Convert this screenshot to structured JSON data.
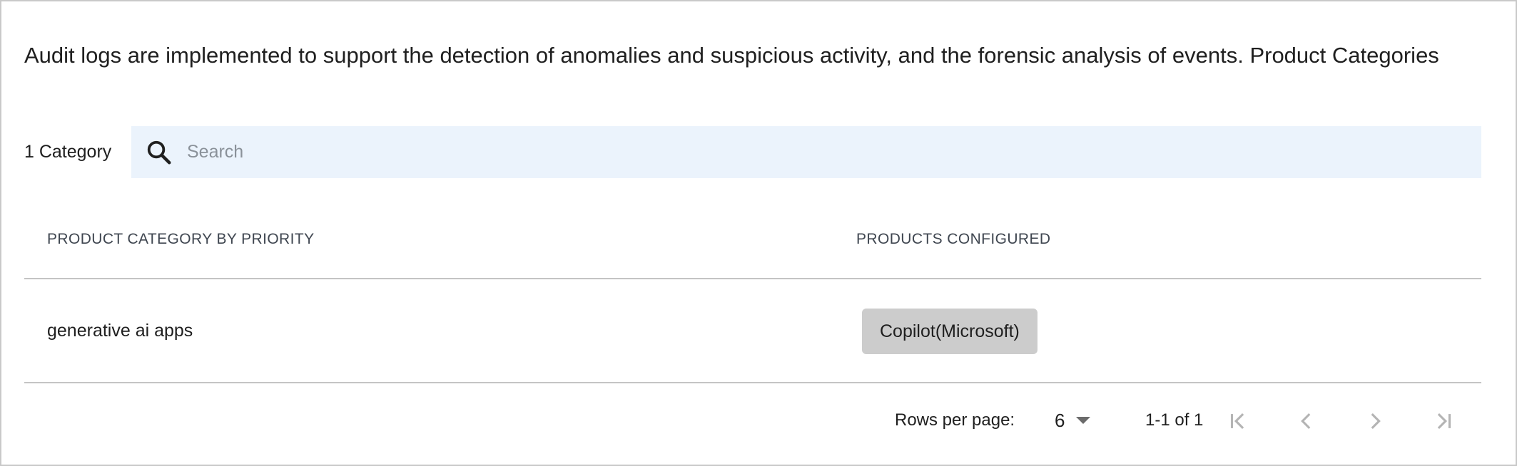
{
  "description": "Audit logs are implemented to support the detection of anomalies and suspicious activity, and the forensic analysis of events. Product Categories",
  "toolbar": {
    "count_label": "1 Category",
    "search_placeholder": "Search",
    "search_value": ""
  },
  "table": {
    "columns": [
      "PRODUCT CATEGORY BY PRIORITY",
      "PRODUCTS CONFIGURED"
    ],
    "rows": [
      {
        "category": "generative ai apps",
        "products": [
          "Copilot(Microsoft)"
        ]
      }
    ]
  },
  "pagination": {
    "rows_per_page_label": "Rows per page:",
    "rows_per_page_value": "6",
    "range_label": "1-1 of 1"
  },
  "icons": {
    "search": "search-icon",
    "first": "first-page-icon",
    "prev": "chevron-left-icon",
    "next": "chevron-right-icon",
    "last": "last-page-icon"
  },
  "colors": {
    "search_bg": "#ebf3fc",
    "chip_bg": "#cccccc",
    "disabled_icon": "#b4b4b4"
  }
}
